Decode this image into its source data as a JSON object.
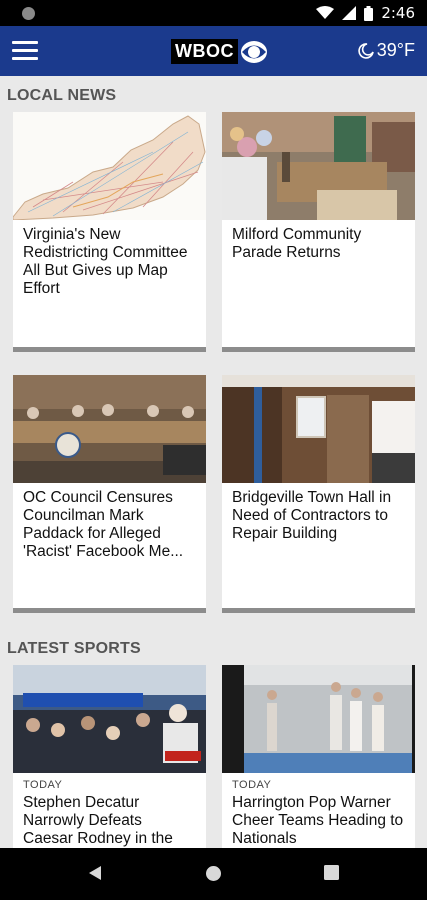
{
  "status_bar": {
    "time": "2:46"
  },
  "header": {
    "logo": "WBOC",
    "temperature": "39°F"
  },
  "sections": {
    "local_news": "LOCAL NEWS",
    "latest_sports": "LATEST SPORTS"
  },
  "local_news": [
    {
      "headline": "Virginia's New Redistricting Committee All But Gives up Map Effort"
    },
    {
      "headline": "Milford Community Parade Returns"
    },
    {
      "headline": "OC Council Censures Councilman Mark Paddack for Alleged 'Racist' Facebook Me..."
    },
    {
      "headline": "Bridgeville Town Hall in Need of Contractors to Repair Building"
    }
  ],
  "latest_sports": [
    {
      "label": "TODAY",
      "headline": "Stephen Decatur Narrowly Defeats Caesar Rodney in the"
    },
    {
      "label": "TODAY",
      "headline": "Harrington Pop Warner Cheer Teams Heading to Nationals"
    }
  ],
  "colors": {
    "app_bar": "#1b3a8d",
    "background": "#e9e9e9"
  }
}
